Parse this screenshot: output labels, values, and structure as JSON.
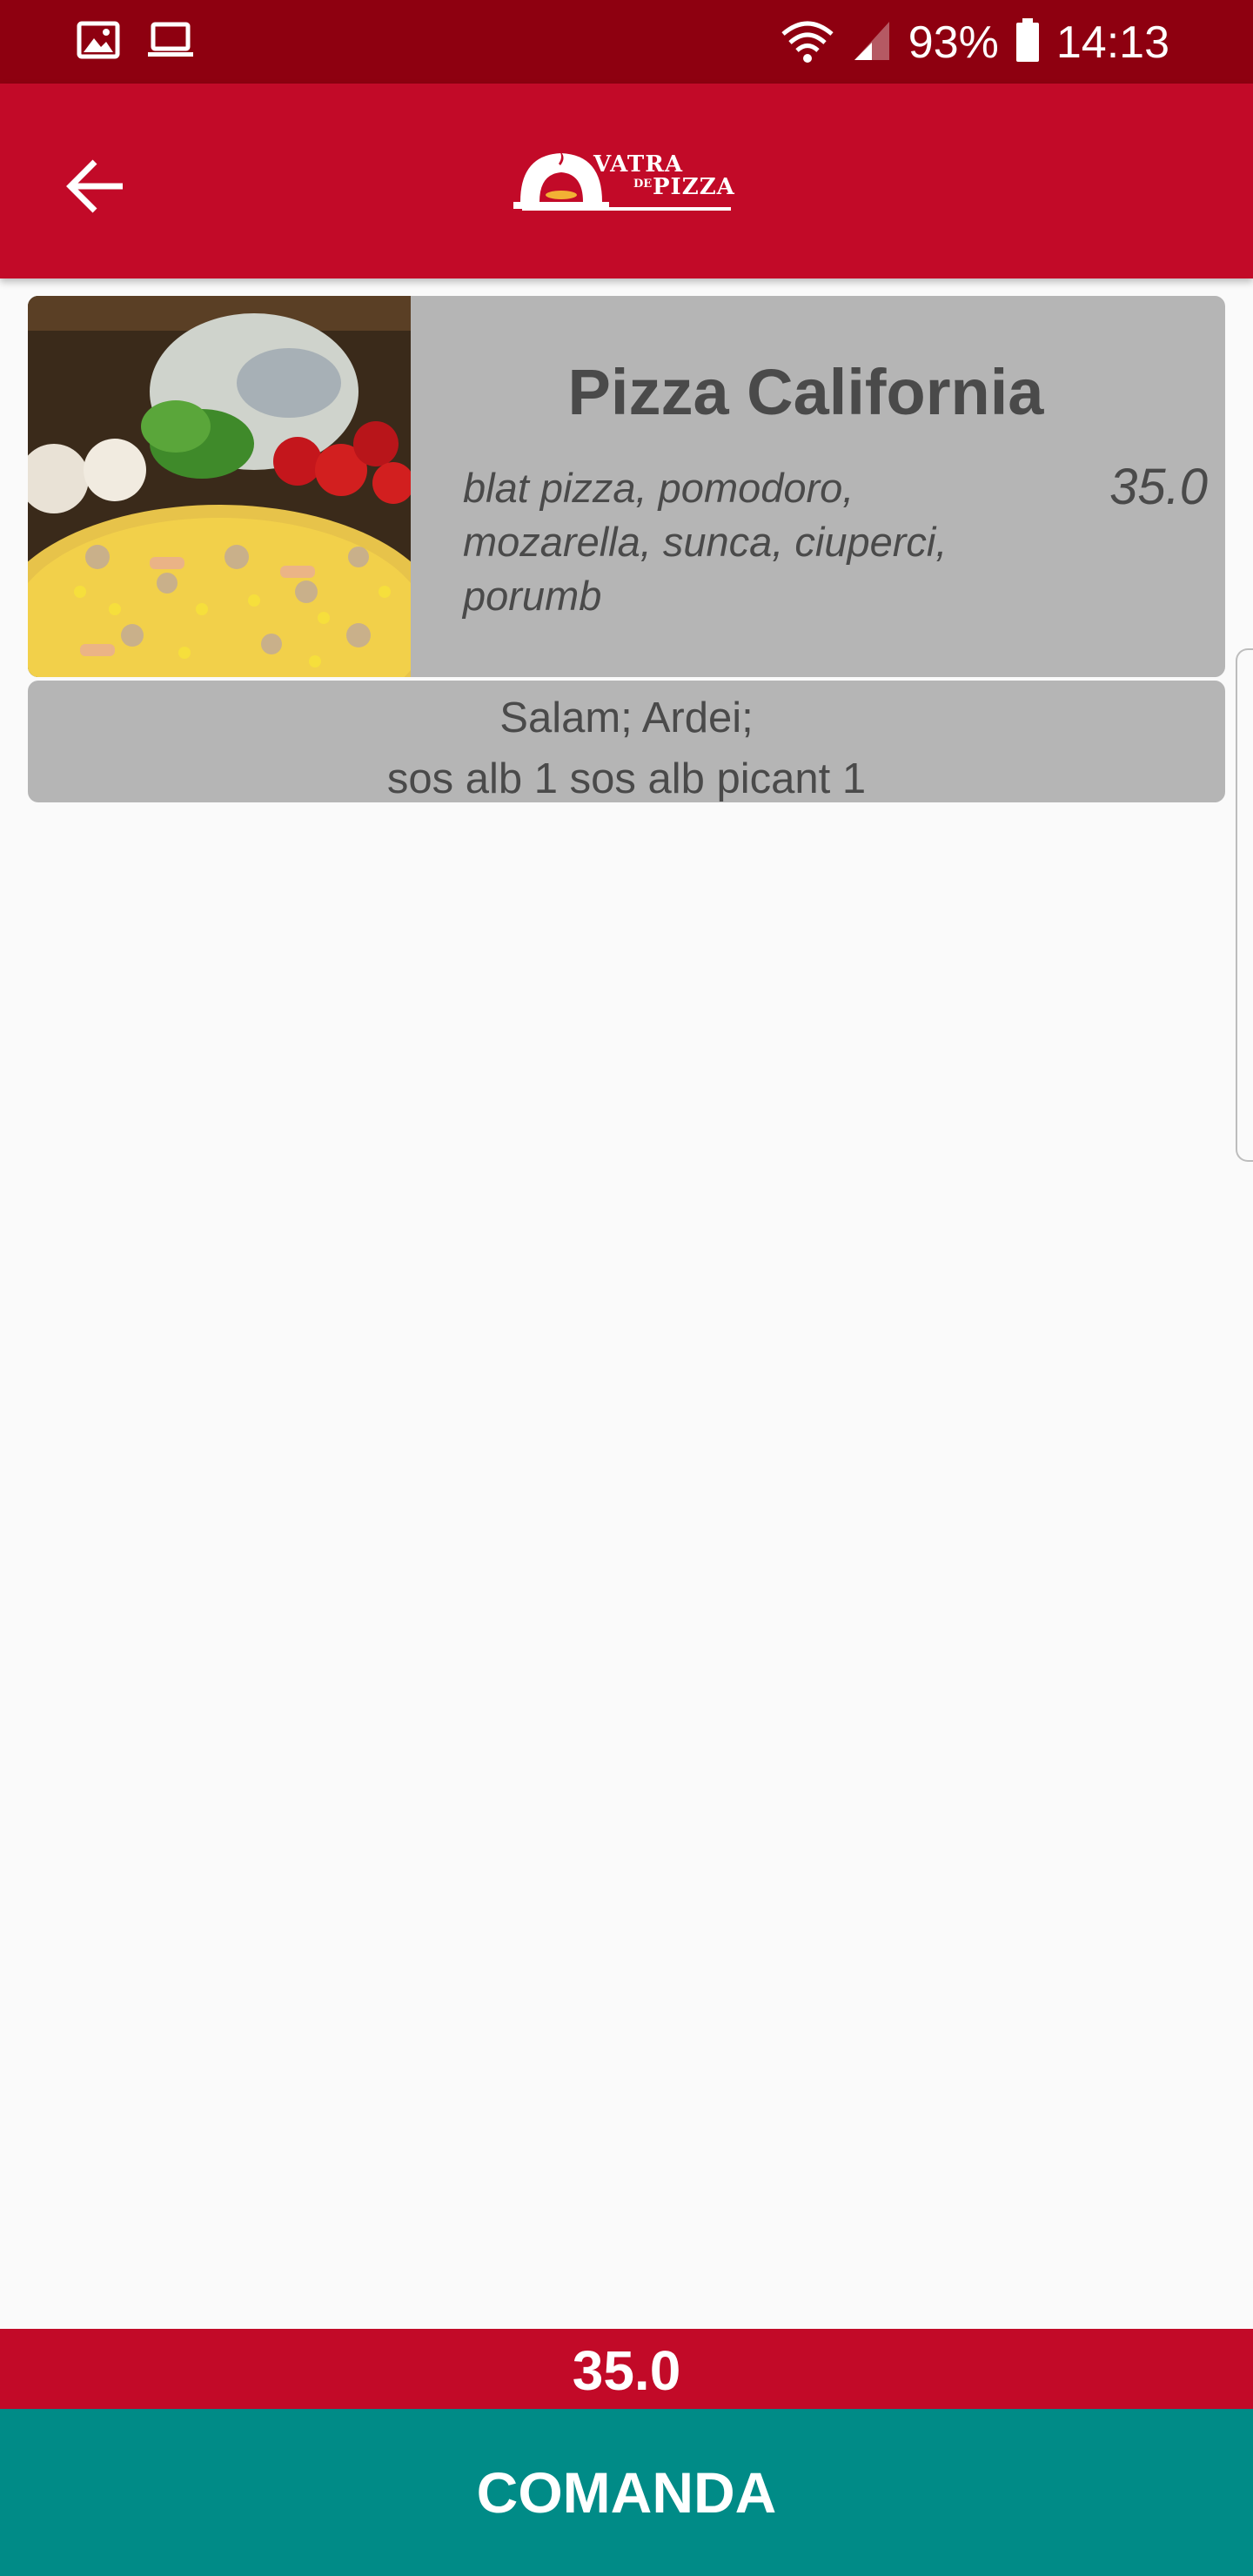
{
  "status_bar": {
    "battery": "93%",
    "time": "14:13",
    "icons": [
      "image-icon",
      "laptop-icon",
      "wifi-icon",
      "signal-icon",
      "battery-icon"
    ]
  },
  "app_bar": {
    "back_icon": "arrow-left-icon",
    "logo": {
      "line1": "VATRA",
      "de": "DE",
      "line2": "PIZZA"
    }
  },
  "product": {
    "title": "Pizza California",
    "description": "blat pizza, pomodoro, mozarella, sunca, ciuperci, porumb",
    "price": "35.0",
    "image": "pizza-photo"
  },
  "options": {
    "line1": "Salam; Ardei;",
    "line2": "sos alb 1 sos alb picant 1"
  },
  "footer": {
    "total": "35.0",
    "order_label": "COMANDA"
  },
  "colors": {
    "status_bar": "#8e0010",
    "app_bar": "#c20a28",
    "card": "#b5b5b5",
    "order_button": "#008b87",
    "background": "#fafafa"
  }
}
